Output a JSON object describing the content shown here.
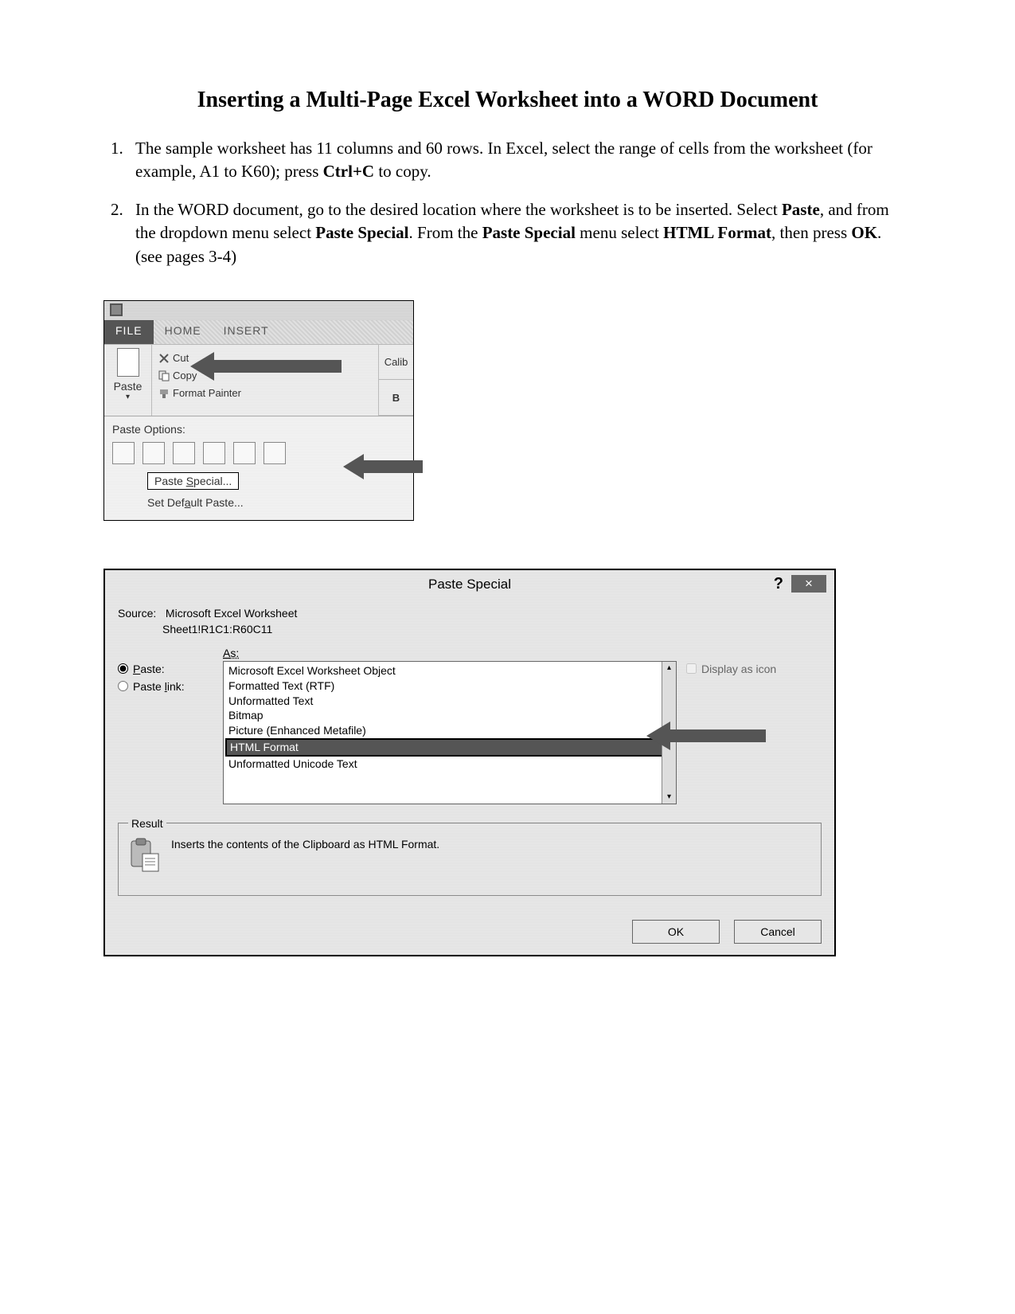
{
  "title": "Inserting a Multi-Page Excel Worksheet into a WORD Document",
  "steps": {
    "s1a": "The sample worksheet has 11 columns and 60 rows. In Excel, select the range of cells from the worksheet (for example, A1 to K60); press ",
    "s1b": "Ctrl+C",
    "s1c": " to copy.",
    "s2a": "In the WORD document, go to the desired location where the worksheet is to be inserted. Select ",
    "s2b": "Paste",
    "s2c": ", and from the dropdown menu select ",
    "s2d": "Paste Special",
    "s2e": ". From the ",
    "s2f": "Paste Special",
    "s2g": " menu select ",
    "s2h": "HTML Format",
    "s2i": ", then press ",
    "s2j": "OK",
    "s2k": ". (see pages 3-4)"
  },
  "fig1": {
    "tabs": {
      "file": "FILE",
      "home": "HOME",
      "insert": "INSERT"
    },
    "paste": "Paste",
    "cut": "Cut",
    "copy": "Copy",
    "fpainter": "Format Painter",
    "font": "Calib",
    "bold": "B",
    "dropdown": {
      "header": "Paste Options:",
      "paste_special": "Paste Special...",
      "set_default": "Set Default Paste..."
    }
  },
  "fig2": {
    "title": "Paste Special",
    "help": "?",
    "close": "×",
    "source_label": "Source:",
    "source_value": "Microsoft Excel Worksheet",
    "source_range": "Sheet1!R1C1:R60C11",
    "as_label": "As:",
    "radio_paste": "Paste:",
    "radio_paste_link": "Paste link:",
    "options": {
      "o1": "Microsoft Excel Worksheet Object",
      "o2": "Formatted Text (RTF)",
      "o3": "Unformatted Text",
      "o4": "Bitmap",
      "o5": "Picture (Enhanced Metafile)",
      "o6": "HTML Format",
      "o7": "Unformatted Unicode Text"
    },
    "display_icon": "Display as icon",
    "result_legend": "Result",
    "result_text": "Inserts the contents of the Clipboard as HTML Format.",
    "ok": "OK",
    "cancel": "Cancel"
  }
}
